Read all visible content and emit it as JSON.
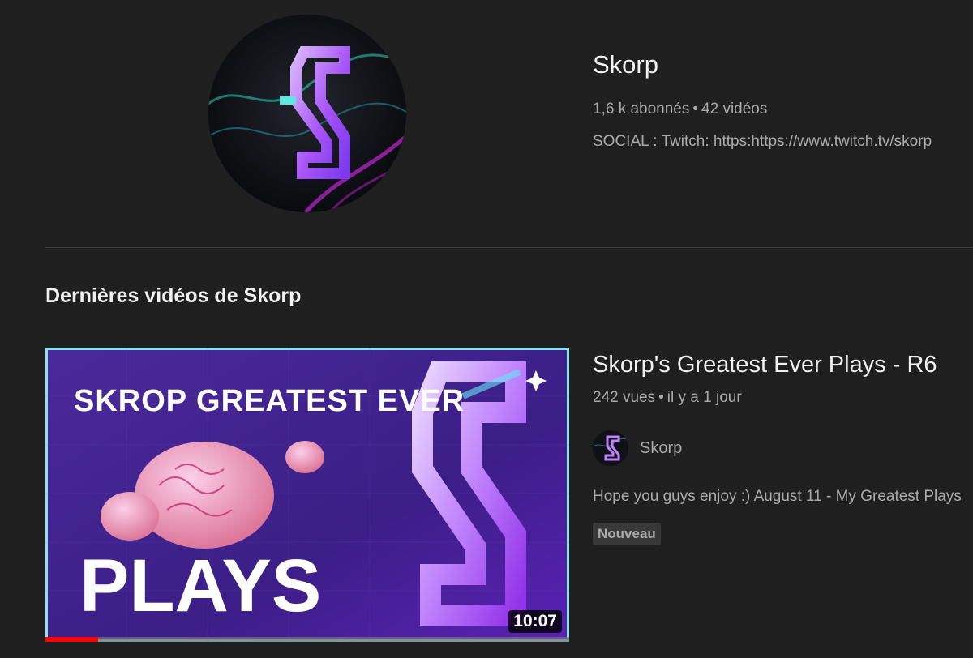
{
  "channel": {
    "name": "Skorp",
    "subscribers": "1,6 k abonnés",
    "videos_count": "42 vidéos",
    "separator": "•",
    "description": "SOCIAL : Twitch: https:https://www.twitch.tv/skorp"
  },
  "section": {
    "title": "Dernières vidéos de Skorp"
  },
  "video": {
    "title": "Skorp's Greatest Ever Plays - R6",
    "views": "242 vues",
    "age": "il y a 1 jour",
    "author": "Skorp",
    "description": "Hope you guys enjoy :) August 11 - My Greatest Plays",
    "badge": "Nouveau",
    "duration": "10:07",
    "watch_progress": 0.1,
    "thumbnail": {
      "headline": "SKROP GREATEST EVER",
      "big_word": "PLAYS"
    }
  },
  "colors": {
    "background": "#1f1f1f",
    "accent_red": "#ff0000",
    "logo_purple": "#a855f7",
    "logo_cyan": "#5ee7e0"
  }
}
